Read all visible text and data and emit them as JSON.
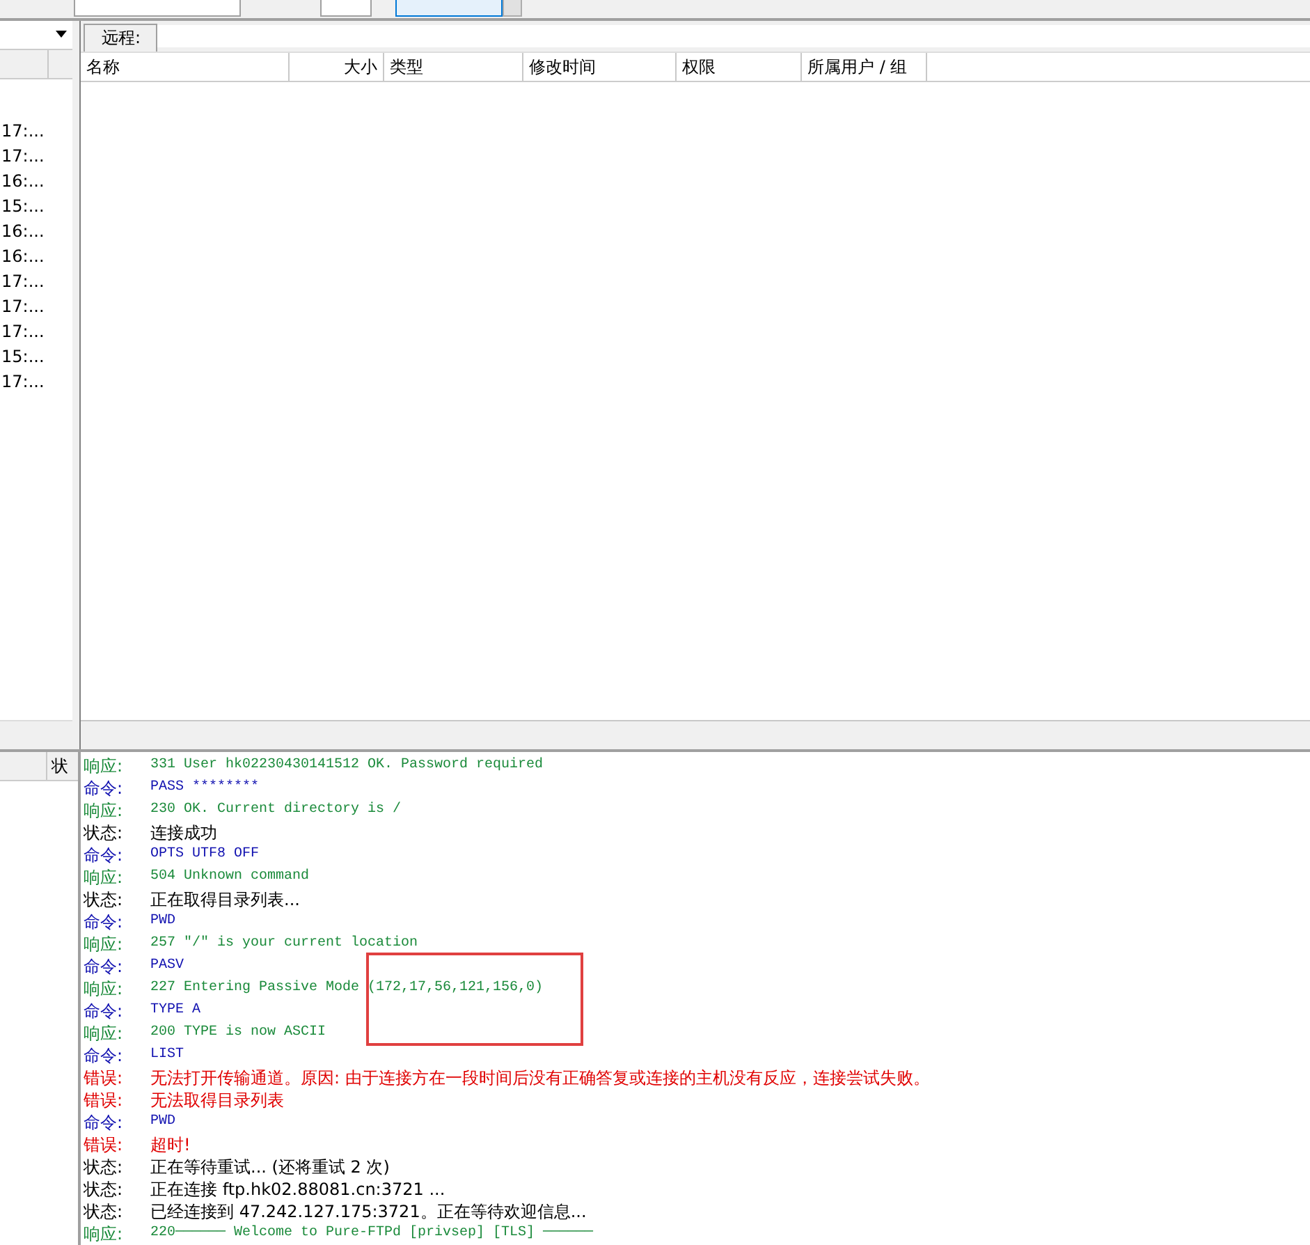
{
  "local_panel": {
    "times": [
      "17:...",
      "17:...",
      "16:...",
      "15:...",
      "16:...",
      "16:...",
      "17:...",
      "17:...",
      "17:...",
      "15:...",
      "17:..."
    ],
    "status_header": "状"
  },
  "remote_panel": {
    "tab_label": "远程:",
    "columns": [
      "名称",
      "大小",
      "类型",
      "修改时间",
      "权限",
      "所属用户 / 组"
    ]
  },
  "log": [
    {
      "kind": "response",
      "label": "响应:",
      "text": "331 User hk02230430141512 OK. Password required"
    },
    {
      "kind": "command",
      "label": "命令:",
      "text": "PASS ********"
    },
    {
      "kind": "response",
      "label": "响应:",
      "text": "230 OK. Current directory is /"
    },
    {
      "kind": "status",
      "label": "状态:",
      "text": "连接成功"
    },
    {
      "kind": "command",
      "label": "命令:",
      "text": "OPTS UTF8 OFF"
    },
    {
      "kind": "response",
      "label": "响应:",
      "text": "504 Unknown command"
    },
    {
      "kind": "status",
      "label": "状态:",
      "text": "正在取得目录列表..."
    },
    {
      "kind": "command",
      "label": "命令:",
      "text": "PWD"
    },
    {
      "kind": "response",
      "label": "响应:",
      "text": "257 \"/\" is your current location"
    },
    {
      "kind": "command",
      "label": "命令:",
      "text": "PASV"
    },
    {
      "kind": "response",
      "label": "响应:",
      "text": "227 Entering Passive Mode (172,17,56,121,156,0)"
    },
    {
      "kind": "command",
      "label": "命令:",
      "text": "TYPE A"
    },
    {
      "kind": "response",
      "label": "响应:",
      "text": "200 TYPE is now ASCII"
    },
    {
      "kind": "command",
      "label": "命令:",
      "text": "LIST"
    },
    {
      "kind": "error",
      "label": "错误:",
      "text": "无法打开传输通道。原因: 由于连接方在一段时间后没有正确答复或连接的主机没有反应，连接尝试失败。"
    },
    {
      "kind": "error",
      "label": "错误:",
      "text": "无法取得目录列表"
    },
    {
      "kind": "command",
      "label": "命令:",
      "text": "PWD"
    },
    {
      "kind": "error",
      "label": "错误:",
      "text": "超时!"
    },
    {
      "kind": "status",
      "label": "状态:",
      "text": "正在等待重试... (还将重试 2 次)"
    },
    {
      "kind": "status",
      "label": "状态:",
      "text": "正在连接 ftp.hk02.88081.cn:3721 ..."
    },
    {
      "kind": "status",
      "label": "状态:",
      "text": "已经连接到 47.242.127.175:3721。正在等待欢迎信息..."
    },
    {
      "kind": "response",
      "label": "响应:",
      "text": "220────── Welcome to Pure-FTPd [privsep] [TLS] ──────"
    }
  ]
}
